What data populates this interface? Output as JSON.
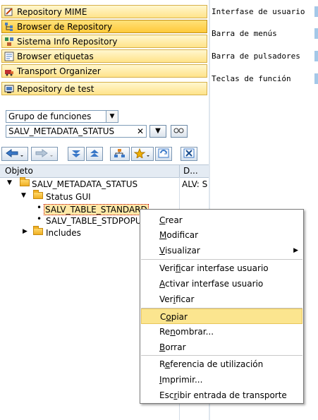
{
  "nav": [
    {
      "label": "Repository MIME",
      "active": false,
      "icon": "mime-repository-icon"
    },
    {
      "label": "Browser de Repository",
      "active": true,
      "icon": "repository-browser-icon"
    },
    {
      "label": "Sistema Info Repository",
      "active": false,
      "icon": "info-system-icon"
    },
    {
      "label": "Browser etiquetas",
      "active": false,
      "icon": "tag-browser-icon"
    },
    {
      "label": "Transport Organizer",
      "active": false,
      "icon": "transport-organizer-icon"
    },
    {
      "label": "Repository de test",
      "active": false,
      "icon": "test-repository-icon"
    }
  ],
  "object_type": "Grupo de funciones",
  "object_name": "SALV_METADATA_STATUS",
  "tree": {
    "col_object": "Objeto",
    "col_desc": "D...",
    "root": {
      "label": "SALV_METADATA_STATUS",
      "desc": "ALV: S"
    },
    "status_gui": "Status GUI",
    "items": [
      "SALV_TABLE_STANDARD",
      "SALV_TABLE_STDPOPUP"
    ],
    "includes": "Includes"
  },
  "right_labels": [
    "Interfase de usuario",
    "Barra de menús",
    "Barra de pulsadores",
    "Teclas de función"
  ],
  "menu": {
    "crear": {
      "u": "C",
      "rest": "rear"
    },
    "modificar": {
      "u": "M",
      "rest": "odificar"
    },
    "visualizar": {
      "u": "V",
      "rest": "isualizar"
    },
    "verificar_int": {
      "pre": "Veri",
      "u": "f",
      "rest": "icar interfase usuario"
    },
    "activar_int": {
      "u": "A",
      "rest": "ctivar interfase usuario"
    },
    "verificar": {
      "pre": "Ver",
      "u": "i",
      "rest": "ficar"
    },
    "copiar": {
      "pre": "C",
      "u": "o",
      "rest": "piar"
    },
    "renombrar": {
      "pre": "Re",
      "u": "n",
      "rest": "ombrar..."
    },
    "borrar": {
      "u": "B",
      "rest": "orrar"
    },
    "referencia": {
      "pre": "R",
      "u": "e",
      "rest": "ferencia de utilización"
    },
    "imprimir": {
      "u": "I",
      "rest": "mprimir..."
    },
    "escribir": {
      "pre": "Esc",
      "u": "r",
      "rest": "ibir entrada de transporte"
    }
  },
  "colors": {
    "highlight": "#fbe58f",
    "nav_active": "#ffc93a",
    "panel_bar": "#a4c8e8"
  }
}
